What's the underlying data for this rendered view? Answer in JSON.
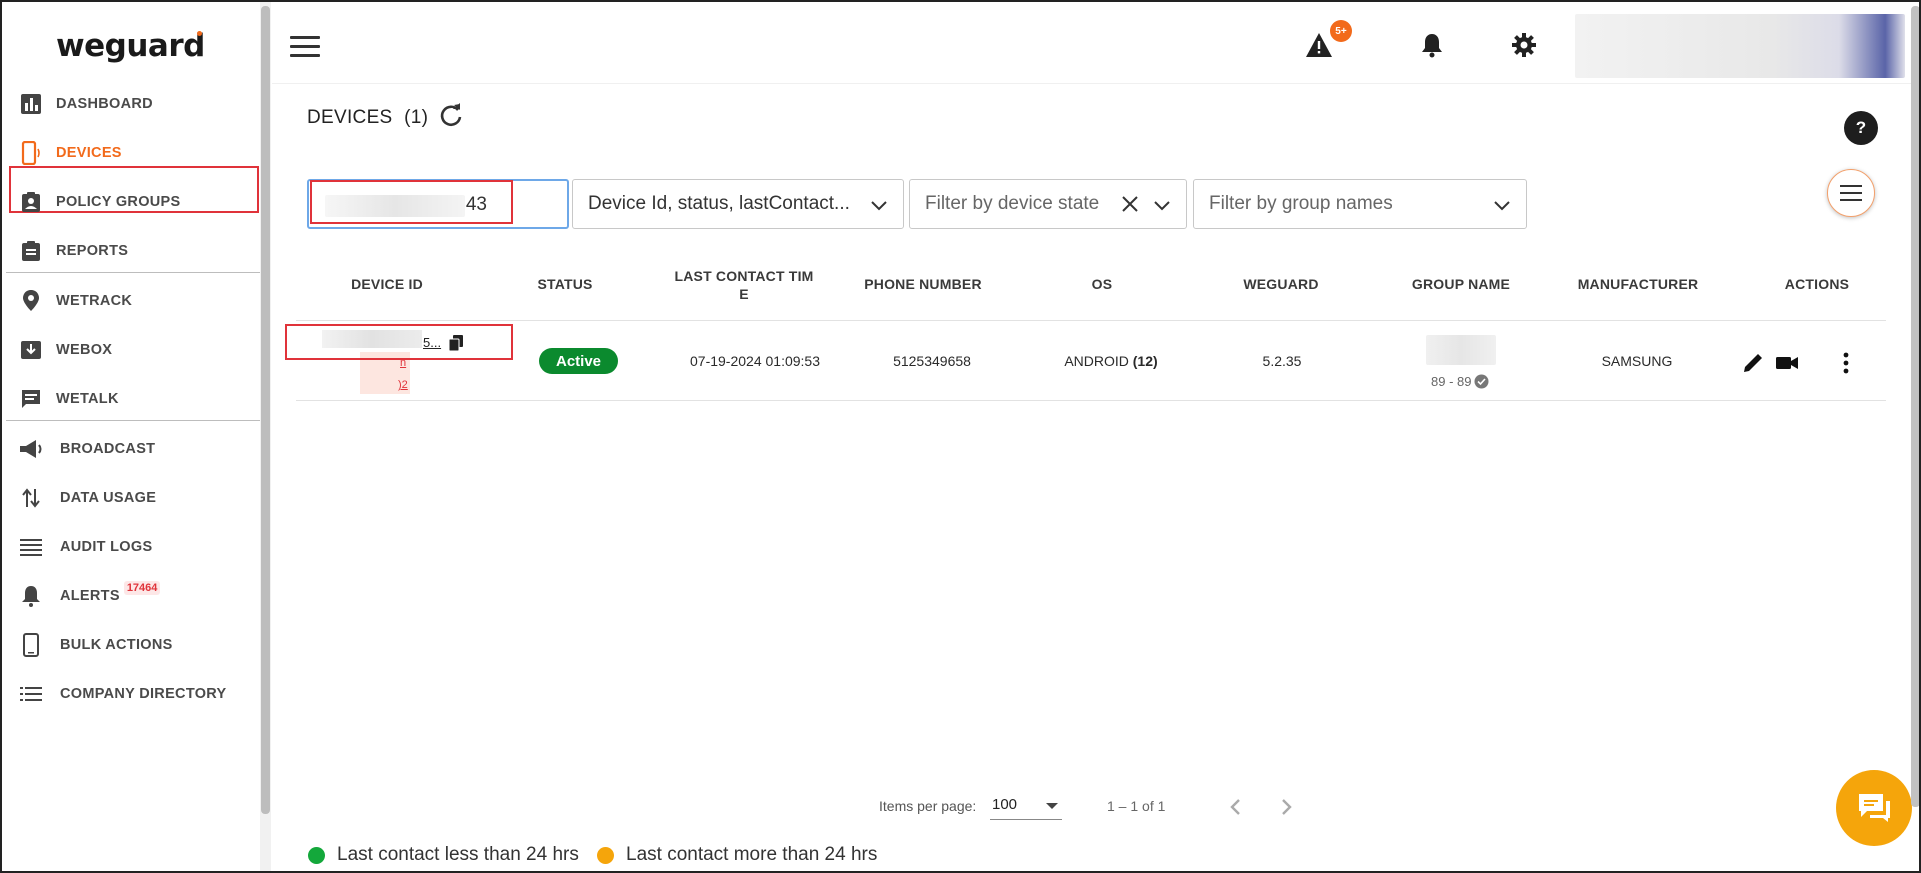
{
  "brand": {
    "name": "weguard"
  },
  "sidebar": {
    "items": [
      {
        "label": "DASHBOARD",
        "icon": "bar-chart-icon"
      },
      {
        "label": "DEVICES",
        "icon": "mobile-device-icon"
      },
      {
        "label": "POLICY GROUPS",
        "icon": "clipboard-user-icon"
      },
      {
        "label": "REPORTS",
        "icon": "report-clipboard-icon"
      },
      {
        "label": "WETRACK",
        "icon": "location-pin-icon"
      },
      {
        "label": "WEBOX",
        "icon": "inbox-download-icon"
      },
      {
        "label": "WETALK",
        "icon": "chat-message-icon"
      },
      {
        "label": "BROADCAST",
        "icon": "megaphone-icon"
      },
      {
        "label": "DATA USAGE",
        "icon": "up-down-arrows-icon"
      },
      {
        "label": "AUDIT LOGS",
        "icon": "lines-icon"
      },
      {
        "label": "ALERTS",
        "icon": "alarm-bell-icon",
        "badge": "17464"
      },
      {
        "label": "BULK ACTIONS",
        "icon": "phone-icon"
      },
      {
        "label": "COMPANY DIRECTORY",
        "icon": "list-icon"
      }
    ],
    "active": "DEVICES"
  },
  "topbar": {
    "warning_badge": "5+"
  },
  "page": {
    "title": "DEVICES",
    "count": "(1)"
  },
  "filters": {
    "search_value": "43",
    "sort_select": "Device Id, status, lastContact...",
    "device_state_placeholder": "Filter by device state",
    "group_names_placeholder": "Filter by group names"
  },
  "table": {
    "columns": [
      "DEVICE ID",
      "STATUS",
      "LAST CONTACT TIME",
      "PHONE NUMBER",
      "OS",
      "WEGUARD",
      "GROUP NAME",
      "MANUFACTURER",
      "ACTIONS"
    ],
    "last_contact_header_line1": "LAST CONTACT TIM",
    "last_contact_header_line2": "E",
    "rows": [
      {
        "device_id_tail": "5...",
        "device_id_sub1": "n",
        "device_id_sub2": ")2",
        "status": "Active",
        "last_contact": "07-19-2024 01:09:53",
        "phone": "5125349658",
        "os": "ANDROID",
        "os_version": "(12)",
        "weguard": "5.2.35",
        "group_sub": "89 - 89",
        "manufacturer": "SAMSUNG"
      }
    ]
  },
  "pagination": {
    "items_per_page_label": "Items per page:",
    "items_per_page": "100",
    "range": "1 – 1 of 1"
  },
  "legend": {
    "recent": {
      "label": "Last contact less than 24 hrs",
      "color": "#14a83b"
    },
    "stale": {
      "label": "Last contact more than 24 hrs",
      "color": "#f5a50b"
    }
  },
  "colors": {
    "accent": "#f26a1b",
    "active_status": "#0b8a2e",
    "highlight": "#e0333a"
  }
}
